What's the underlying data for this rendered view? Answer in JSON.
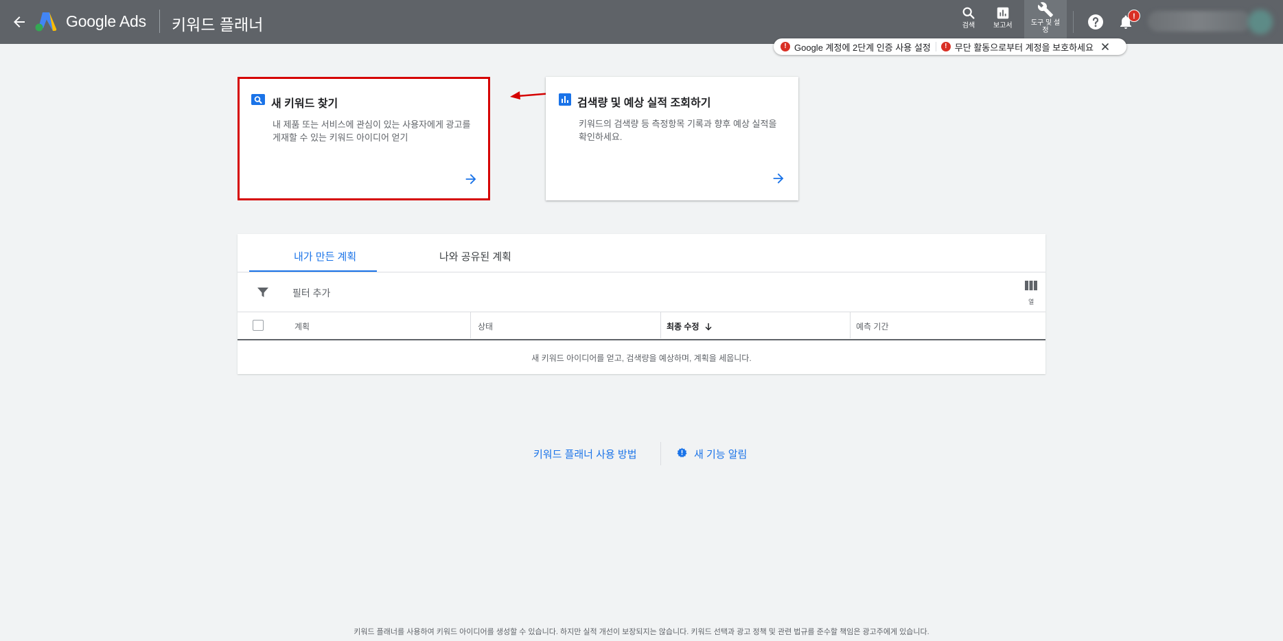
{
  "header": {
    "product": "Google Ads",
    "page_title": "키워드 플래너",
    "search_label": "검색",
    "reports_label": "보고서",
    "tools_label": "도구 및 설정",
    "notification_badge": "!"
  },
  "security_banner": {
    "item1": "Google 계정에 2단계 인증 사용 설정",
    "item2": "무단 활동으로부터 계정을 보호하세요",
    "warn_glyph": "!"
  },
  "cards": [
    {
      "title": "새 키워드 찾기",
      "description": "내 제품 또는 서비스에 관심이 있는 사용자에게 광고를 게재할 수 있는 키워드 아이디어 얻기",
      "icon": "search-icon"
    },
    {
      "title": "검색량 및 예상 실적 조회하기",
      "description": "키워드의 검색량 등 측정항목 기록과 향후 예상 실적을 확인하세요.",
      "icon": "bar-chart-icon"
    }
  ],
  "plans": {
    "tabs": [
      "내가 만든 계획",
      "나와 공유된 계획"
    ],
    "active_tab": 0,
    "filter_label": "필터 추가",
    "columns_label": "열",
    "columns": [
      "계획",
      "상태",
      "최종 수정",
      "예측 기간"
    ],
    "sorted_column": "최종 수정",
    "empty_message": "새 키워드 아이디어를 얻고, 검색량을 예상하며, 계획을 세웁니다."
  },
  "footer": {
    "how_to": "키워드 플래너 사용 방법",
    "whats_new": "새 기능 알림",
    "disclaimer": "키워드 플래너를 사용하여 키워드 아이디어를 생성할 수 있습니다. 하지만 실적 개선이 보장되지는 않습니다. 키워드 선택과 광고 정책 및 관련 법규를 준수할 책임은 광고주에게 있습니다."
  },
  "colors": {
    "header_bg": "#5f6368",
    "accent_blue": "#1a73e8",
    "highlight_red": "#d50000",
    "warning_red": "#d93025"
  }
}
